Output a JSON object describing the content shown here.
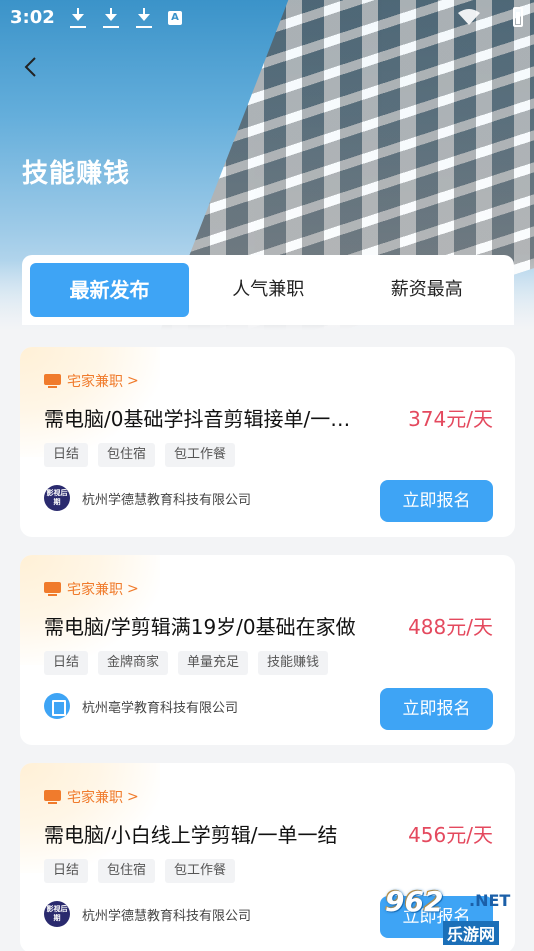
{
  "status_bar": {
    "time": "3:02",
    "a_label": "A"
  },
  "header": {
    "title": "技能赚钱"
  },
  "tabs": [
    {
      "label": "最新发布",
      "active": true
    },
    {
      "label": "人气兼职",
      "active": false
    },
    {
      "label": "薪资最高",
      "active": false
    }
  ],
  "jobs": [
    {
      "category": "宅家兼职",
      "title": "需电脑/0基础学抖音剪辑接单/一…",
      "salary": "374元/天",
      "tags": [
        "日结",
        "包住宿",
        "包工作餐"
      ],
      "company": "杭州学德慧教育科技有限公司",
      "logo_text": "影视后期",
      "apply_label": "立即报名"
    },
    {
      "category": "宅家兼职",
      "title": "需电脑/学剪辑满19岁/0基础在家做",
      "salary": "488元/天",
      "tags": [
        "日结",
        "金牌商家",
        "单量充足",
        "技能赚钱"
      ],
      "company": "杭州亳学教育科技有限公司",
      "logo_text": "",
      "apply_label": "立即报名"
    },
    {
      "category": "宅家兼职",
      "title": "需电脑/小白线上学剪辑/一单一结",
      "salary": "456元/天",
      "tags": [
        "日结",
        "包住宿",
        "包工作餐"
      ],
      "company": "杭州学德慧教育科技有限公司",
      "logo_text": "影视后期",
      "apply_label": "立即报名"
    }
  ],
  "watermark": {
    "top": "962",
    "net": ".NET",
    "bottom": "乐游网"
  },
  "colors": {
    "accent": "#3ea4f5",
    "salary": "#e4495e",
    "category": "#f07b2c"
  }
}
